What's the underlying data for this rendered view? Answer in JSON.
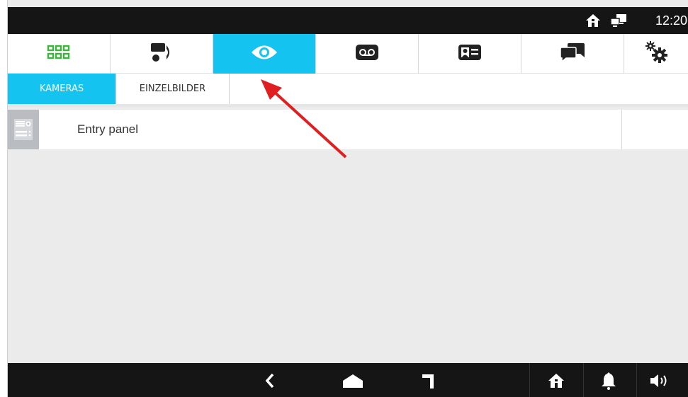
{
  "statusbar": {
    "time": "12:20",
    "icons": [
      "home-icon",
      "network-icon"
    ]
  },
  "toptabs": [
    {
      "icon": "apps-grid-icon",
      "active": false
    },
    {
      "icon": "intercom-handset-icon",
      "active": false
    },
    {
      "icon": "eye-icon",
      "active": true
    },
    {
      "icon": "voicemail-icon",
      "active": false
    },
    {
      "icon": "contact-card-icon",
      "active": false
    },
    {
      "icon": "chat-icon",
      "active": false
    },
    {
      "icon": "settings-gears-icon",
      "active": false
    }
  ],
  "subtabs": {
    "cameras_label": "KAMERAS",
    "snapshots_label": "EINZELBILDER"
  },
  "list": {
    "items": [
      {
        "label": "Entry panel",
        "icon": "entry-panel-icon"
      }
    ]
  },
  "bottombar": {
    "icons": [
      "back-icon",
      "home-shape-icon",
      "recent-apps-icon",
      "home-icon",
      "bell-icon",
      "volume-icon"
    ]
  },
  "colors": {
    "accent": "#14c3ef",
    "green": "#3cb53c",
    "bar": "#151515",
    "arrow": "#e02020"
  }
}
